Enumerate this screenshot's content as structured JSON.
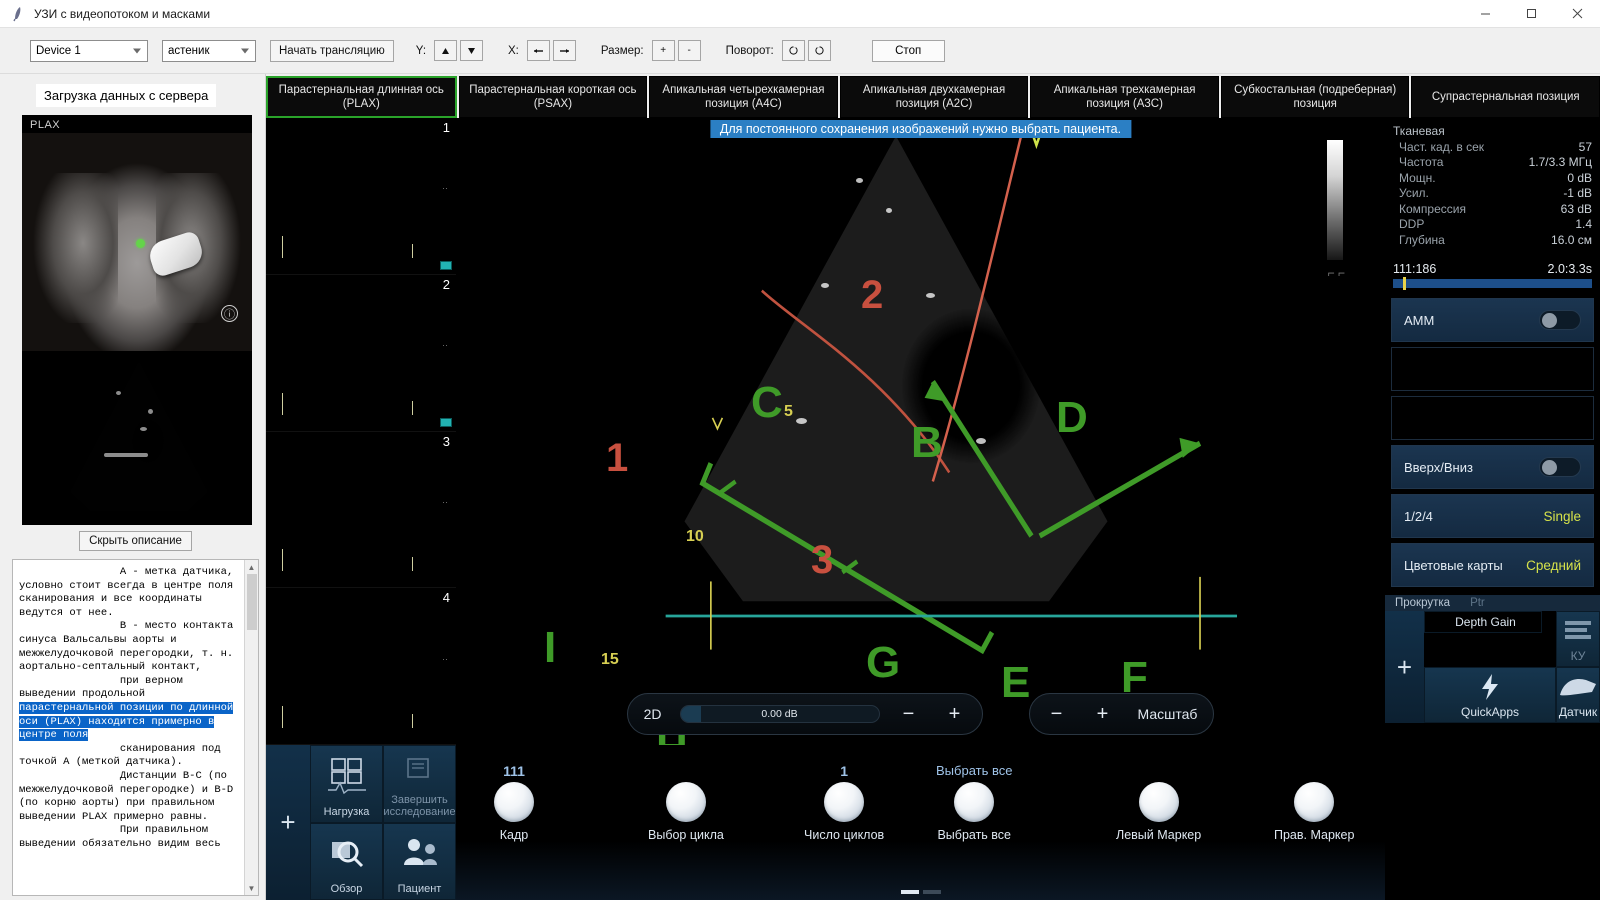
{
  "window": {
    "title": "УЗИ с видеопотоком и масками",
    "minimize": "—",
    "maximize": "□",
    "close": "✕"
  },
  "toolbar": {
    "device_select": "Device 1",
    "body_type_select": "астеник",
    "start_button": "Начать трансляцию",
    "y_label": "Y:",
    "y_up": "▲",
    "y_down": "▼",
    "x_label": "X:",
    "x_left": "⇤",
    "x_right": "⇥",
    "size_label": "Размер:",
    "size_plus": "+",
    "size_minus": "-",
    "rotate_label": "Поворот:",
    "rotate_ccw": "↺",
    "rotate_cw": "↻",
    "stop_button": "Стоп"
  },
  "left_panel": {
    "load_status": "Загрузка данных с сервера",
    "image_label": "PLAX",
    "info_glyph": "ⓘ",
    "hide_description_button": "Скрыть описание",
    "description_before": "                А - метка датчика,\nусловно стоит всегда в центре поля\nсканирования и все координаты\nведутся от нее.\n                В - место контакта\nсинуса Вальсальвы аорты и\nмежжелудочковой перегородки, т. н.\nаортально-септальный контакт,\n                при верном\nвыведении продольной",
    "description_highlight": "\nпарастернальной позиции по длинной\nоси (PLAX) находится примерно в\nцентре поля",
    "description_after": "\n                сканирования под\nточкой А (меткой датчика).\n                Дистанции В-С (по\nмежжелудочковой перегородке) и B-D\n(по корню аорты) при правильном\nвыведении PLAX примерно равны.\n                При правильном\nвыведении обязательно видим весь"
  },
  "tabs": [
    {
      "label": "Парастернальная длинная ось (PLAX)",
      "active": true
    },
    {
      "label": "Парастернальная короткая ось (PSAX)",
      "active": false
    },
    {
      "label": "Апикальная четырехкамерная позиция (A4C)",
      "active": false
    },
    {
      "label": "Апикальная двухкамерная позиция (A2C)",
      "active": false
    },
    {
      "label": "Апикальная трехкамерная позиция (A3C)",
      "active": false
    },
    {
      "label": "Субкостальная (подреберная) позиция",
      "active": false
    },
    {
      "label": "Супрастернальная позиция",
      "active": false
    }
  ],
  "thumbnails": [
    {
      "number": "1"
    },
    {
      "number": "2"
    },
    {
      "number": "3"
    },
    {
      "number": "4"
    }
  ],
  "stage": {
    "banner": "Для постоянного сохранения изображений нужно выбрать пациента.",
    "annotations": {
      "green_letters": [
        "C",
        "B",
        "D",
        "G",
        "E",
        "F",
        "I",
        "H"
      ],
      "red_numbers": [
        "1",
        "2",
        "3"
      ],
      "yellow_numbers": [
        "5",
        "10",
        "15"
      ]
    },
    "controls": {
      "mode_label": "2D",
      "gain_value": "0.00 dB",
      "minus": "−",
      "plus": "+",
      "zoom_label": "Масштаб"
    }
  },
  "bottom_tiles": [
    {
      "label": "Нагрузка",
      "icon": "grid-ecg-icon",
      "disabled": false
    },
    {
      "label": "Завершить исследование",
      "icon": "finish-study-icon",
      "disabled": true
    },
    {
      "label": "Обзор",
      "icon": "magnifier-icon",
      "disabled": false
    },
    {
      "label": "Пациент",
      "icon": "patient-icon",
      "disabled": false
    }
  ],
  "bottom_plus": "+",
  "knobs": [
    {
      "value": "111",
      "label": "Кадр"
    },
    {
      "value": "",
      "label": "Выбор цикла"
    },
    {
      "value": "1",
      "label": "Число циклов"
    },
    {
      "value": "Выбрать все",
      "label": "Выбрать все"
    },
    {
      "value": "",
      "label": "Левый Маркер"
    },
    {
      "value": "",
      "label": "Прав. Маркер"
    }
  ],
  "rail": {
    "mode_title": "Тканевая",
    "params": [
      {
        "name": "Част. кад. в сек",
        "value": "57"
      },
      {
        "name": "Частота",
        "value": "1.7/3.3 МГц"
      },
      {
        "name": "Мощн.",
        "value": "0 dB"
      },
      {
        "name": "Усил.",
        "value": "-1 dB"
      },
      {
        "name": "Компрессия",
        "value": "63 dB"
      },
      {
        "name": "DDP",
        "value": "1.4"
      },
      {
        "name": "Глубина",
        "value": "16.0 см"
      }
    ],
    "meter_left": "111:186",
    "meter_right": "2.0:3.3s",
    "buttons": [
      {
        "label": "AMM",
        "type": "toggle"
      },
      {
        "label": "",
        "type": "empty"
      },
      {
        "label": "",
        "type": "empty"
      },
      {
        "label": "Вверх/Вниз",
        "type": "toggle"
      },
      {
        "label": "1/2/4",
        "value": "Single",
        "type": "value"
      },
      {
        "label": "Цветовые карты",
        "value": "Средний",
        "type": "value"
      }
    ],
    "sub_left": "Прокрутка",
    "sub_right": "Ptr",
    "tiles": [
      {
        "label": "Depth Gain",
        "icon": "depth-gain-icon",
        "selected": true
      },
      {
        "label": "КУ",
        "icon": "lines-icon",
        "selected": false,
        "dim": true
      },
      {
        "label": "QuickApps",
        "icon": "lightning-icon",
        "selected": false
      },
      {
        "label": "Датчик",
        "icon": "probe-icon",
        "selected": false
      }
    ],
    "plus": "+"
  },
  "colors": {
    "accent_green": "#2aa32a",
    "annotation_green": "#3f9b28",
    "annotation_red": "#c8503f",
    "annotation_yellow": "#d7cf52",
    "banner_blue": "#2b7fc4",
    "highlight_blue": "#0a64c8",
    "rail_value_yellow": "#d6e24a"
  }
}
